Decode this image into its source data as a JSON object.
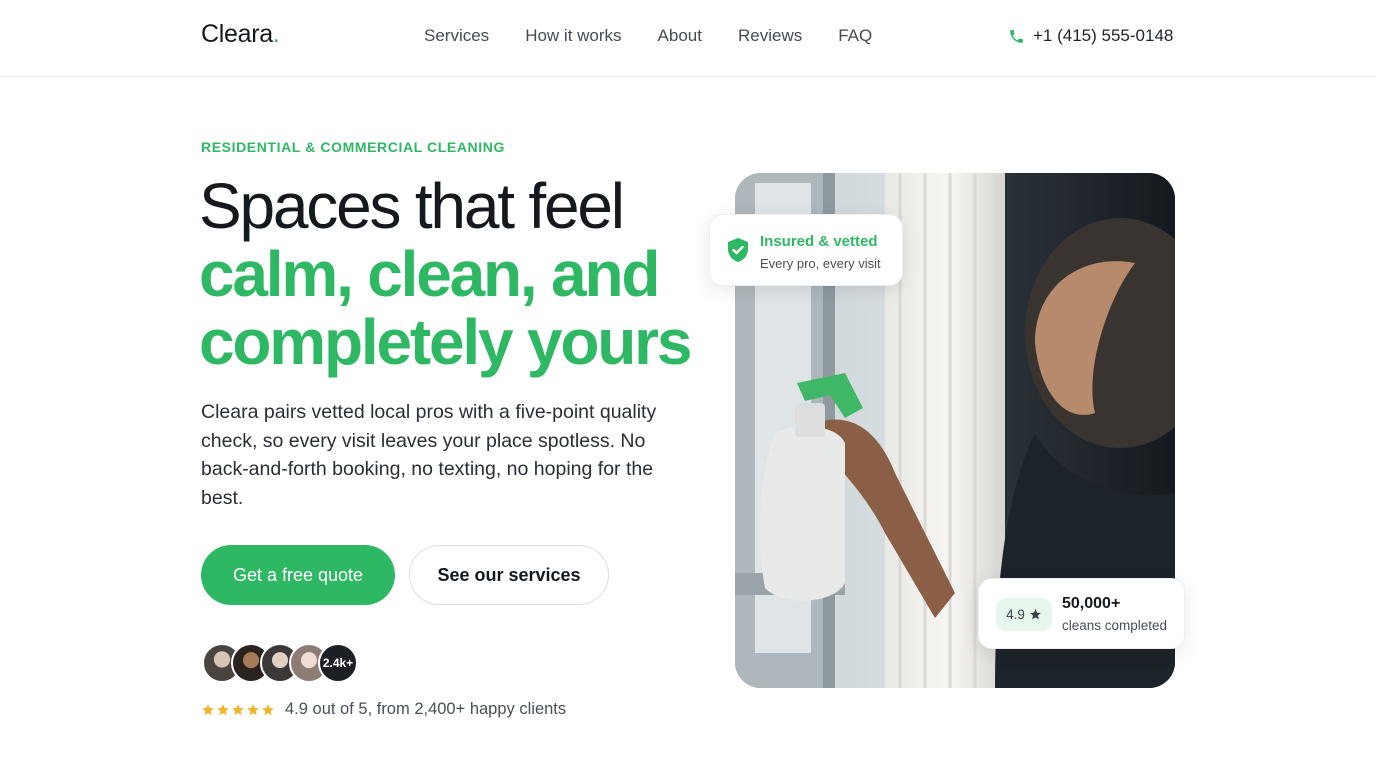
{
  "header": {
    "logo_text": "Cleara",
    "logo_dot": ".",
    "nav": [
      "Services",
      "How it works",
      "About",
      "Reviews",
      "FAQ"
    ],
    "phone": "+1 (415) 555-0148",
    "phone_icon": "phone-icon"
  },
  "hero": {
    "eyebrow": "RESIDENTIAL & COMMERCIAL CLEANING",
    "headline_line1": "Spaces that feel",
    "headline_line2": "calm, clean, and",
    "headline_line3": "completely yours",
    "lead": "Cleara pairs vetted local pros with a five-point quality check, so every visit leaves your place spotless. No back-and-forth booking, no texting, no hoping for the best.",
    "primary_cta": "Get a free quote",
    "secondary_cta": "See our services",
    "avatar_count_label": "2.4k+",
    "rating_text": "4.9 out of 5, from 2,400+ happy clients",
    "star_count": 5
  },
  "badges": {
    "insured_title": "Insured & vetted",
    "insured_sub": "Every pro, every visit",
    "rating_value": "4.9",
    "cleans_value": "50,000+",
    "cleans_label": "cleans completed"
  },
  "colors": {
    "accent": "#2fb864",
    "star": "#f0b429",
    "text": "#15181c"
  }
}
